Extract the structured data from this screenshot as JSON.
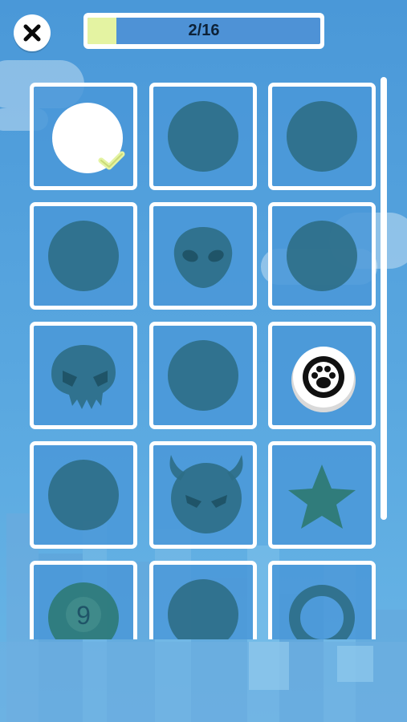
{
  "header": {
    "progress_text": "2/16",
    "progress_fraction": 0.125
  },
  "colors": {
    "background": "#4a98d8",
    "locked_ball": "#2e6e86",
    "selected_ball": "#ffffff",
    "check": "#e4f3a2",
    "progress_fill": "#e4f3a2"
  },
  "grid": {
    "tiles": [
      {
        "skin": "white-ball",
        "state": "selected"
      },
      {
        "skin": "plain-ball",
        "state": "locked"
      },
      {
        "skin": "plain-ball",
        "state": "locked"
      },
      {
        "skin": "plain-ball",
        "state": "locked"
      },
      {
        "skin": "alien-ball",
        "state": "locked"
      },
      {
        "skin": "plain-ball",
        "state": "locked"
      },
      {
        "skin": "skull-ball",
        "state": "locked"
      },
      {
        "skin": "plain-ball",
        "state": "locked"
      },
      {
        "skin": "paw-ball",
        "state": "unlocked"
      },
      {
        "skin": "plain-ball",
        "state": "locked"
      },
      {
        "skin": "devil-ball",
        "state": "locked"
      },
      {
        "skin": "star-ball",
        "state": "locked"
      },
      {
        "skin": "pool-nine-ball",
        "state": "locked",
        "label": "9"
      },
      {
        "skin": "plain-ball",
        "state": "locked"
      },
      {
        "skin": "ring-ball",
        "state": "locked"
      }
    ]
  }
}
